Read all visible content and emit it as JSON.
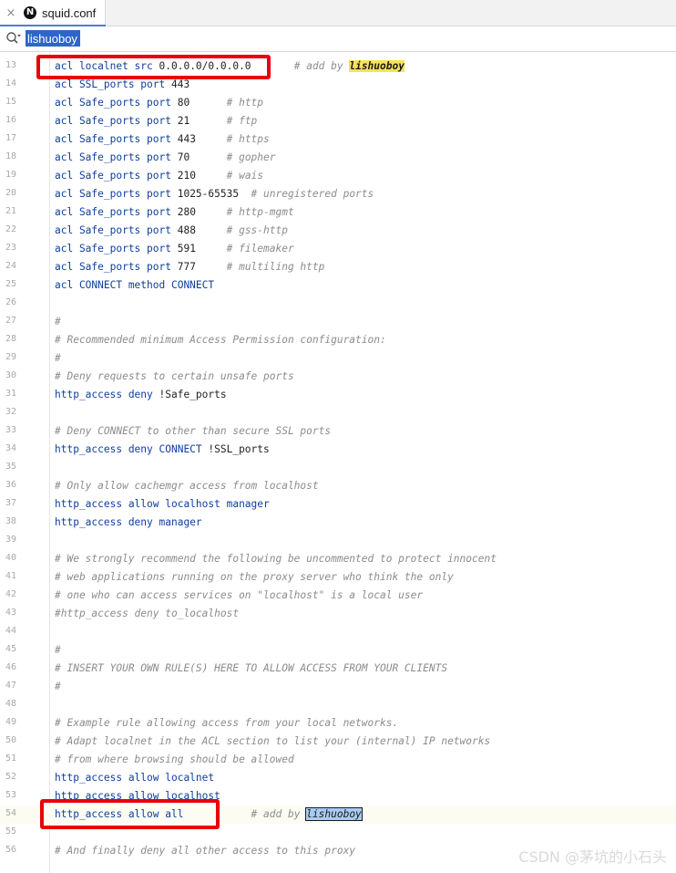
{
  "tab": {
    "filename": "squid.conf",
    "close_glyph": "×",
    "logo_letter": "N"
  },
  "search": {
    "value": "lishuoboy"
  },
  "lines": [
    {
      "n": "13",
      "code": [
        [
          "kw",
          "acl localnet src "
        ],
        [
          "",
          "0.0.0.0/0.0.0.0"
        ],
        [
          "",
          "       "
        ],
        [
          "cm",
          "# add by "
        ],
        [
          "hl",
          "lishuoboy"
        ]
      ]
    },
    {
      "n": "14",
      "code": [
        [
          "kw",
          "acl SSL_ports port "
        ],
        [
          "",
          "443"
        ]
      ]
    },
    {
      "n": "15",
      "code": [
        [
          "kw",
          "acl Safe_ports port "
        ],
        [
          "",
          "80      "
        ],
        [
          "cm",
          "# http"
        ]
      ]
    },
    {
      "n": "16",
      "code": [
        [
          "kw",
          "acl Safe_ports port "
        ],
        [
          "",
          "21      "
        ],
        [
          "cm",
          "# ftp"
        ]
      ]
    },
    {
      "n": "17",
      "code": [
        [
          "kw",
          "acl Safe_ports port "
        ],
        [
          "",
          "443     "
        ],
        [
          "cm",
          "# https"
        ]
      ]
    },
    {
      "n": "18",
      "code": [
        [
          "kw",
          "acl Safe_ports port "
        ],
        [
          "",
          "70      "
        ],
        [
          "cm",
          "# gopher"
        ]
      ]
    },
    {
      "n": "19",
      "code": [
        [
          "kw",
          "acl Safe_ports port "
        ],
        [
          "",
          "210     "
        ],
        [
          "cm",
          "# wais"
        ]
      ]
    },
    {
      "n": "20",
      "code": [
        [
          "kw",
          "acl Safe_ports port "
        ],
        [
          "",
          "1025-65535  "
        ],
        [
          "cm",
          "# unregistered ports"
        ]
      ]
    },
    {
      "n": "21",
      "code": [
        [
          "kw",
          "acl Safe_ports port "
        ],
        [
          "",
          "280     "
        ],
        [
          "cm",
          "# http-mgmt"
        ]
      ]
    },
    {
      "n": "22",
      "code": [
        [
          "kw",
          "acl Safe_ports port "
        ],
        [
          "",
          "488     "
        ],
        [
          "cm",
          "# gss-http"
        ]
      ]
    },
    {
      "n": "23",
      "code": [
        [
          "kw",
          "acl Safe_ports port "
        ],
        [
          "",
          "591     "
        ],
        [
          "cm",
          "# filemaker"
        ]
      ]
    },
    {
      "n": "24",
      "code": [
        [
          "kw",
          "acl Safe_ports port "
        ],
        [
          "",
          "777     "
        ],
        [
          "cm",
          "# multiling http"
        ]
      ]
    },
    {
      "n": "25",
      "code": [
        [
          "kw",
          "acl CONNECT method CONNECT"
        ]
      ]
    },
    {
      "n": "26",
      "code": []
    },
    {
      "n": "27",
      "code": [
        [
          "cm",
          "#"
        ]
      ]
    },
    {
      "n": "28",
      "code": [
        [
          "cm",
          "# Recommended minimum Access Permission configuration:"
        ]
      ]
    },
    {
      "n": "29",
      "code": [
        [
          "cm",
          "#"
        ]
      ]
    },
    {
      "n": "30",
      "code": [
        [
          "cm",
          "# Deny requests to certain unsafe ports"
        ]
      ]
    },
    {
      "n": "31",
      "code": [
        [
          "kw",
          "http_access deny "
        ],
        [
          "",
          "!Safe_ports"
        ]
      ]
    },
    {
      "n": "32",
      "code": []
    },
    {
      "n": "33",
      "code": [
        [
          "cm",
          "# Deny CONNECT to other than secure SSL ports"
        ]
      ]
    },
    {
      "n": "34",
      "code": [
        [
          "kw",
          "http_access deny CONNECT "
        ],
        [
          "",
          "!SSL_ports"
        ]
      ]
    },
    {
      "n": "35",
      "code": []
    },
    {
      "n": "36",
      "code": [
        [
          "cm",
          "# Only allow cachemgr access from localhost"
        ]
      ]
    },
    {
      "n": "37",
      "code": [
        [
          "kw",
          "http_access allow localhost manager"
        ]
      ]
    },
    {
      "n": "38",
      "code": [
        [
          "kw",
          "http_access deny manager"
        ]
      ]
    },
    {
      "n": "39",
      "code": []
    },
    {
      "n": "40",
      "code": [
        [
          "cm",
          "# We strongly recommend the following be uncommented to protect innocent"
        ]
      ]
    },
    {
      "n": "41",
      "code": [
        [
          "cm",
          "# web applications running on the proxy server who think the only"
        ]
      ]
    },
    {
      "n": "42",
      "code": [
        [
          "cm",
          "# one who can access services on \"localhost\" is a local user"
        ]
      ]
    },
    {
      "n": "43",
      "code": [
        [
          "cm",
          "#http_access deny to_localhost"
        ]
      ]
    },
    {
      "n": "44",
      "code": []
    },
    {
      "n": "45",
      "code": [
        [
          "cm",
          "#"
        ]
      ]
    },
    {
      "n": "46",
      "code": [
        [
          "cm",
          "# INSERT YOUR OWN RULE(S) HERE TO ALLOW ACCESS FROM YOUR CLIENTS"
        ]
      ]
    },
    {
      "n": "47",
      "code": [
        [
          "cm",
          "#"
        ]
      ]
    },
    {
      "n": "48",
      "code": []
    },
    {
      "n": "49",
      "code": [
        [
          "cm",
          "# Example rule allowing access from your local networks."
        ]
      ]
    },
    {
      "n": "50",
      "code": [
        [
          "cm",
          "# Adapt localnet in the ACL section to list your (internal) IP networks"
        ]
      ]
    },
    {
      "n": "51",
      "code": [
        [
          "cm",
          "# from where browsing should be allowed"
        ]
      ]
    },
    {
      "n": "52",
      "code": [
        [
          "kw",
          "http_access allow localnet"
        ]
      ]
    },
    {
      "n": "53",
      "code": [
        [
          "kw",
          "http_access allow localhost"
        ]
      ]
    },
    {
      "n": "54",
      "code": [
        [
          "kw",
          "http_access allow all"
        ],
        [
          "",
          "           "
        ],
        [
          "cm",
          "# add by "
        ],
        [
          "hl2",
          "lishuoboy"
        ]
      ],
      "current": true
    },
    {
      "n": "55",
      "code": []
    },
    {
      "n": "56",
      "code": [
        [
          "cm",
          "# And finally deny all other access to this proxy"
        ]
      ]
    }
  ],
  "watermark": "CSDN @茅坑的小石头",
  "colors": {
    "highlight_box": "#e8000b",
    "keyword": "#0e3e9e",
    "comment": "#8c8c8c",
    "match": "#f7e35a"
  }
}
